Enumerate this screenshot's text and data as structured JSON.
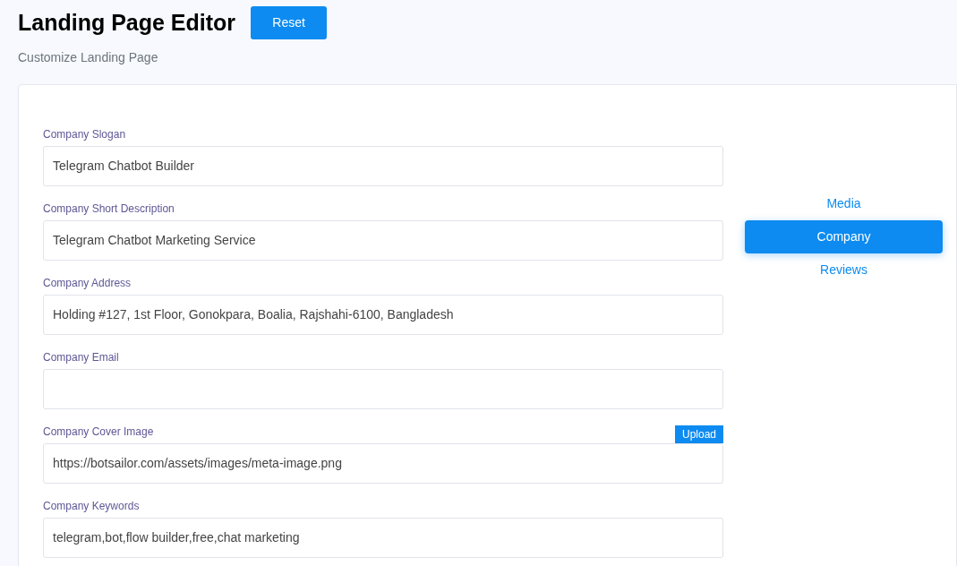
{
  "header": {
    "title": "Landing Page Editor",
    "reset_button": "Reset",
    "subtitle": "Customize Landing Page"
  },
  "fields": [
    {
      "label": "Company Slogan",
      "value": "Telegram Chatbot Builder"
    },
    {
      "label": "Company Short Description",
      "value": "Telegram Chatbot Marketing Service"
    },
    {
      "label": "Company Address",
      "value": "Holding #127, 1st Floor, Gonokpara, Boalia, Rajshahi-6100, Bangladesh"
    },
    {
      "label": "Company Email"
    },
    {
      "label": "Company Cover Image",
      "value": "https://botsailor.com/assets/images/meta-image.png",
      "upload_button": "Upload"
    },
    {
      "label": "Company Keywords",
      "value": "telegram,bot,flow builder,free,chat marketing"
    }
  ],
  "tabs": [
    {
      "label": "Media",
      "selected": false
    },
    {
      "label": "Company",
      "selected": true
    },
    {
      "label": "Reviews",
      "selected": false
    }
  ]
}
